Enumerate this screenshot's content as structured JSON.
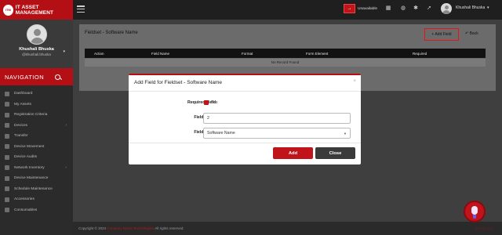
{
  "app": {
    "brand_logo": "ITM",
    "brand_name": "IT ASSET MANAGEMENT"
  },
  "profile": {
    "name": "Khushali Bhuska",
    "handle": "@khushali.bhuska"
  },
  "nav": {
    "title": "NAVIGATION",
    "items": [
      {
        "label": "Dashboard",
        "chevron": false
      },
      {
        "label": "My Assets",
        "chevron": false
      },
      {
        "label": "Registration Criteria",
        "chevron": false
      },
      {
        "label": "Devices",
        "chevron": true
      },
      {
        "label": "Transfer",
        "chevron": false
      },
      {
        "label": "Device Movement",
        "chevron": false
      },
      {
        "label": "Device Audits",
        "chevron": false
      },
      {
        "label": "Network Inventory",
        "chevron": true
      },
      {
        "label": "Device Maintenance",
        "chevron": false
      },
      {
        "label": "Schedule Maintenance",
        "chevron": false
      },
      {
        "label": "Accessories",
        "chevron": false
      },
      {
        "label": "Consumables",
        "chevron": false
      }
    ]
  },
  "topbar": {
    "language_button": "→",
    "language_label": "Unavailable",
    "user_name": "Khushali Bhuska"
  },
  "page": {
    "title": "Fieldset - Software Name",
    "add_field": "+ Add Field",
    "back": "↶ Back",
    "table_headers": [
      "Action",
      "Field Name",
      "Format",
      "Form Element",
      "Required"
    ],
    "empty_message": "No Record Found"
  },
  "modal": {
    "title": "Add Field for Fieldset - Software Name",
    "close_symbol": "×",
    "required_label": "Required Field",
    "required_checked_text": "Yes",
    "order_label": "Field Order",
    "order_value": "2",
    "name_label": "Field Name",
    "name_value": "Software Name",
    "add_button": "Add",
    "close_button": "Close"
  },
  "footer": {
    "prefix": "Copyright © 2024",
    "company": "Company Name Technologies",
    "suffix": "All rights reserved.",
    "right": "Version 1.0"
  },
  "colors": {
    "brand_red": "#b40f15",
    "dark": "#1f1f1f"
  }
}
